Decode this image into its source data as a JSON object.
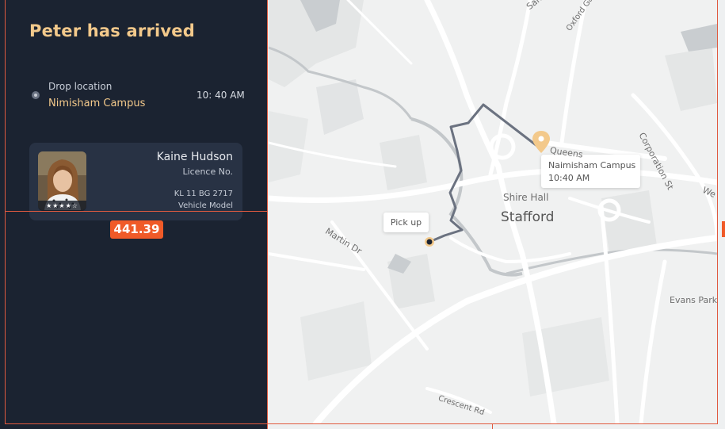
{
  "status": {
    "title": "Peter has arrived"
  },
  "drop": {
    "label": "Drop location",
    "place": "Nimisham Campus",
    "time": "10: 40 AM"
  },
  "driver": {
    "name": "Kaine Hudson",
    "licence_label": "Licence No.",
    "plate": "KL 11 BG 2717",
    "vehicle_label": "Vehicle Model",
    "rating_stars": "★★★★☆",
    "rating": 4
  },
  "measurement": {
    "value": "441.39"
  },
  "map": {
    "pickup_label": "Pick up",
    "destination_name": "Naimisham Campus",
    "destination_time": "10:40 AM",
    "labels": {
      "sandon_rd": "Sandon Rd",
      "oxford_gar": "Oxford Gar",
      "queens": "Queens",
      "corporation_st": "Corporation St",
      "we": "We",
      "shire_hall": "Shire Hall",
      "stafford": "Stafford",
      "martin_dr": "Martin Dr",
      "evans_park": "Evans Park",
      "crescent_rd": "Crescent Rd"
    }
  },
  "colors": {
    "panel_bg": "#1b2331",
    "card_bg": "#283244",
    "accent": "#f3c98b",
    "route": "#6b7280",
    "guide": "#e05a3f",
    "badge": "#f05a28"
  }
}
